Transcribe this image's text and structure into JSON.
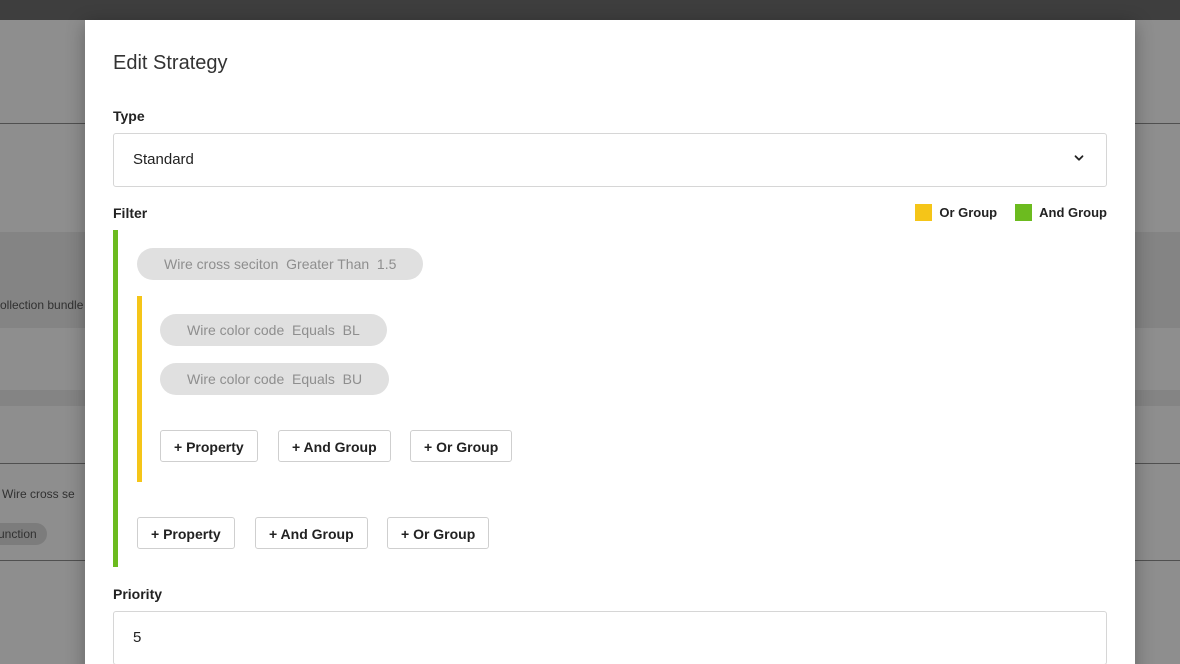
{
  "background": {
    "truncated_text_1": "ollection bundle",
    "truncated_text_2": "Wire cross se",
    "truncated_chip": "unction"
  },
  "modal": {
    "title": "Edit Strategy",
    "type": {
      "label": "Type",
      "value": "Standard",
      "icon": "chevron-down-icon"
    },
    "filter": {
      "label": "Filter",
      "legend": [
        {
          "label": "Or Group",
          "color": "#f5c518"
        },
        {
          "label": "And Group",
          "color": "#6cbb1f"
        }
      ],
      "and_group": {
        "conditions": [
          "Wire cross seciton  Greater Than  1.5"
        ],
        "or_group": {
          "conditions": [
            "Wire color code  Equals  BL",
            "Wire color code  Equals  BU"
          ],
          "buttons": {
            "property": "+ Property",
            "and_group": "+ And Group",
            "or_group": "+ Or Group"
          }
        },
        "buttons": {
          "property": "+ Property",
          "and_group": "+ And Group",
          "or_group": "+ Or Group"
        }
      }
    },
    "priority": {
      "label": "Priority",
      "value": "5"
    }
  }
}
